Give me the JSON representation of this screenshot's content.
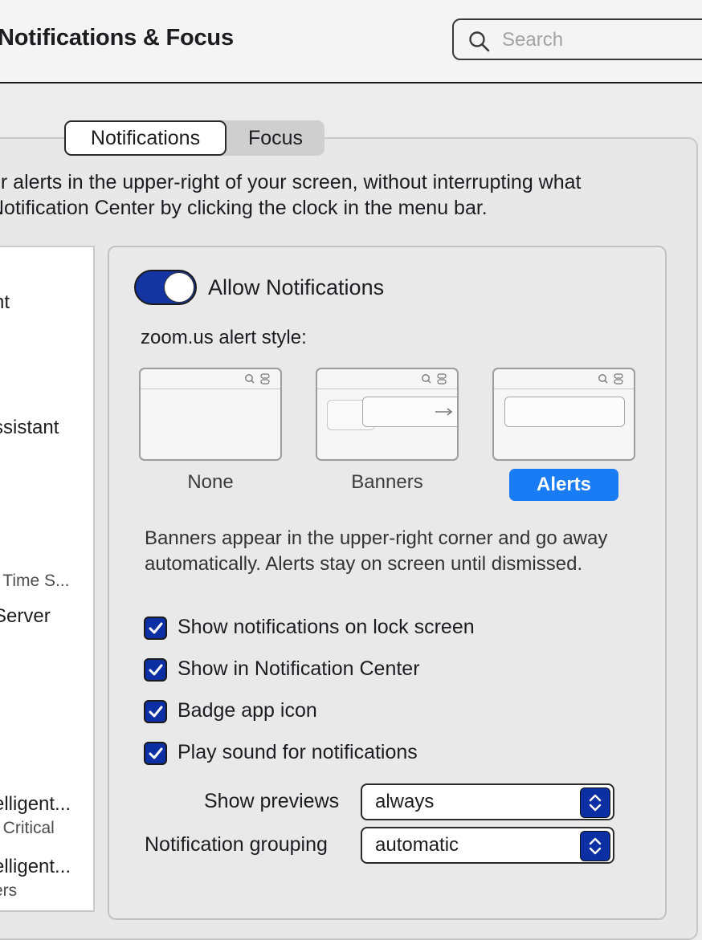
{
  "window": {
    "title": "Notifications & Focus"
  },
  "search": {
    "placeholder": "Search",
    "icon": "magnifying-glass"
  },
  "tabs": {
    "active": "Notifications",
    "inactive": "Focus"
  },
  "description": {
    "line1": "ur alerts in the upper-right of your screen, without interrupting what",
    "line2": "Notification Center by clicking the clock in the menu bar."
  },
  "app_list": [
    {
      "name": "nt"
    },
    {
      "name": "ssistant"
    },
    {
      "sub": ", Time S..."
    },
    {
      "name": "Server"
    },
    {
      "name": "elligent...",
      "sub": ", Critical"
    },
    {
      "name": "elligent...",
      "sub": "ers"
    }
  ],
  "settings": {
    "allow_label": "Allow Notifications",
    "allow_enabled": true,
    "alert_style_label": "zoom.us alert style:",
    "styles": [
      "None",
      "Banners",
      "Alerts"
    ],
    "selected_style": "Alerts",
    "explanation": "Banners appear in the upper-right corner and go away automatically. Alerts stay on screen until dismissed.",
    "checkboxes": [
      {
        "label": "Show notifications on lock screen",
        "checked": true
      },
      {
        "label": "Show in Notification Center",
        "checked": true
      },
      {
        "label": "Badge app icon",
        "checked": true
      },
      {
        "label": "Play sound for notifications",
        "checked": true
      }
    ],
    "show_previews": {
      "label": "Show previews",
      "value": "always"
    },
    "grouping": {
      "label": "Notification grouping",
      "value": "automatic"
    }
  },
  "colors": {
    "accent": "#1a7cf5",
    "control_blue": "#0c2fa3",
    "toggle_on": "#1435a1"
  }
}
